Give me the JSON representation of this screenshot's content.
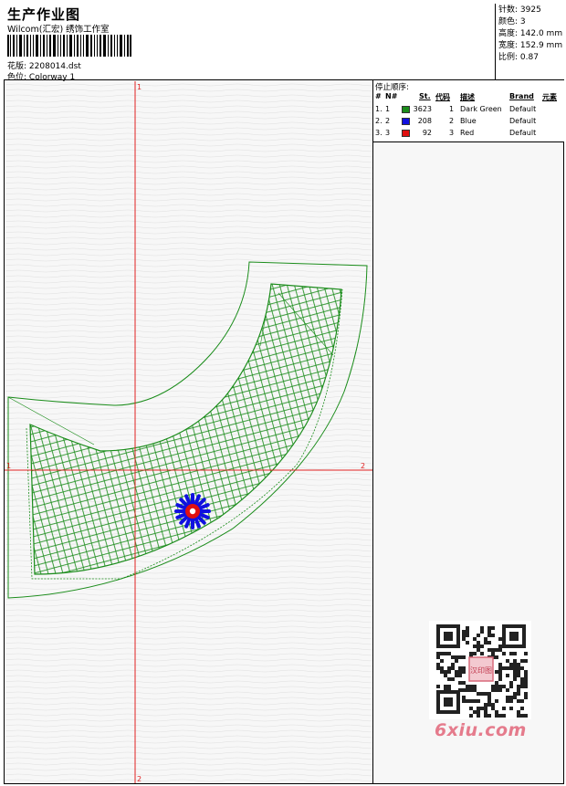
{
  "header": {
    "title": "生产作业图",
    "company": "Wilcom(汇宏) 绣饰工作室",
    "design_label": "花版:",
    "design_value": "2208014.dst",
    "colorway_label": "色位:",
    "colorway_value": "Colorway 1"
  },
  "stats": {
    "stitches_label": "针数:",
    "stitches_value": "3925",
    "colors_label": "颜色:",
    "colors_value": "3",
    "height_label": "高度:",
    "height_value": "142.0 mm",
    "width_label": "宽度:",
    "width_value": "152.9 mm",
    "scale_label": "比例:",
    "scale_value": "0.87"
  },
  "stop_sequence": {
    "title": "停止顺序:",
    "columns": {
      "hash": "#",
      "no": "N#",
      "st": "St.",
      "code": "代码",
      "desc": "描述",
      "brand": "Brand",
      "element": "元素"
    },
    "rows": [
      {
        "hash": "1.",
        "no": "1",
        "st": "3623",
        "code": "1",
        "desc": "Dark Green",
        "brand": "Default",
        "color": "#1a8c1a"
      },
      {
        "hash": "2.",
        "no": "2",
        "st": "208",
        "code": "2",
        "desc": "Blue",
        "brand": "Default",
        "color": "#1010e0"
      },
      {
        "hash": "3.",
        "no": "3",
        "st": "92",
        "code": "3",
        "desc": "Red",
        "brand": "Default",
        "color": "#e01010"
      }
    ]
  },
  "axes": {
    "v_top": "1",
    "v_bottom": "2",
    "h_left": "1",
    "h_right": "2"
  },
  "watermark": {
    "text": "6xiu.com",
    "qr_caption": "汉印图"
  },
  "colors": {
    "thread_green": "#1a8c1a",
    "thread_blue": "#1010e0",
    "thread_red": "#e01010",
    "axis_red": "#e02020"
  }
}
